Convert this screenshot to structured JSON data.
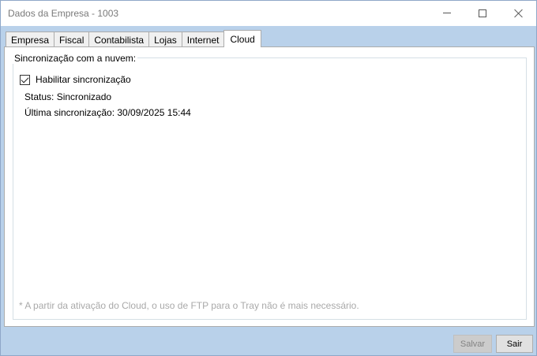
{
  "window": {
    "title": "Dados da Empresa - 1003"
  },
  "tabs": [
    {
      "label": "Empresa"
    },
    {
      "label": "Fiscal"
    },
    {
      "label": "Contabilista"
    },
    {
      "label": "Lojas"
    },
    {
      "label": "Internet"
    },
    {
      "label": "Cloud",
      "active": true
    }
  ],
  "cloud": {
    "group_title": "Sincronização com a nuvem:",
    "enable_label": "Habilitar sincronização",
    "enable_checked": true,
    "status_text": "Status: Sincronizado",
    "last_sync_text": "Última sincronização: 30/09/2025 15:44",
    "note": "* A partir da ativação do Cloud, o uso de FTP para o Tray não é mais necessário."
  },
  "buttons": {
    "save_label": "Salvar",
    "exit_label": "Sair"
  },
  "colors": {
    "window_background": "#b9d1ea",
    "note_text": "#a9a9a9"
  }
}
